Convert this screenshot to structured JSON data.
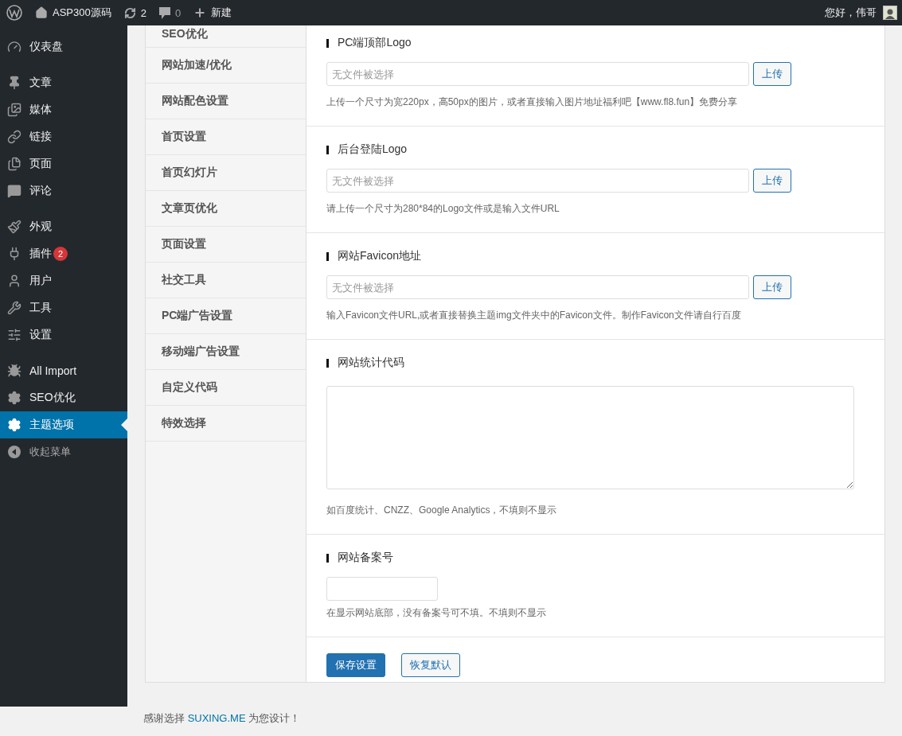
{
  "admin_bar": {
    "site": "ASP300源码",
    "updates": "2",
    "comments": "0",
    "new": "新建",
    "greeting": "您好，伟哥"
  },
  "sidebar": {
    "groups": [
      [
        {
          "label": "仪表盘",
          "selected": false
        }
      ],
      [
        {
          "label": "文章",
          "selected": false
        },
        {
          "label": "媒体",
          "selected": false
        },
        {
          "label": "链接",
          "selected": false
        },
        {
          "label": "页面",
          "selected": false
        },
        {
          "label": "评论",
          "selected": false
        }
      ],
      [
        {
          "label": "外观",
          "selected": false
        },
        {
          "label": "插件",
          "selected": false,
          "badge": "2"
        },
        {
          "label": "用户",
          "selected": false
        },
        {
          "label": "工具",
          "selected": false
        },
        {
          "label": "设置",
          "selected": false
        }
      ],
      [
        {
          "label": "All Import",
          "selected": false
        },
        {
          "label": "SEO优化",
          "selected": false
        },
        {
          "label": "主题选项",
          "selected": true
        }
      ]
    ],
    "collapse": "收起菜单"
  },
  "tabs": [
    {
      "label": "SEO优化"
    },
    {
      "label": "网站加速/优化"
    },
    {
      "label": "网站配色设置"
    },
    {
      "label": "首页设置"
    },
    {
      "label": "首页幻灯片"
    },
    {
      "label": "文章页优化"
    },
    {
      "label": "页面设置"
    },
    {
      "label": "社交工具"
    },
    {
      "label": "PC端广告设置"
    },
    {
      "label": "移动端广告设置"
    },
    {
      "label": "自定义代码"
    },
    {
      "label": "特效选择"
    }
  ],
  "sections": [
    {
      "kind": "upload",
      "title": "PC端顶部Logo",
      "placeholder": "无文件被选择",
      "button": "上传",
      "help": "上传一个尺寸为宽220px，高50px的图片，或者直接输入图片地址福利吧【www.fl8.fun】免费分享"
    },
    {
      "kind": "upload",
      "title": "后台登陆Logo",
      "placeholder": "无文件被选择",
      "button": "上传",
      "help": "请上传一个尺寸为280*84的Logo文件或是输入文件URL"
    },
    {
      "kind": "upload",
      "title": "网站Favicon地址",
      "placeholder": "无文件被选择",
      "button": "上传",
      "help": "输入Favicon文件URL,或者直接替换主题img文件夹中的Favicon文件。制作Favicon文件请自行百度"
    },
    {
      "kind": "textarea",
      "title": "网站统计代码",
      "help": "如百度统计、CNZZ、Google Analytics，不填则不显示"
    },
    {
      "kind": "text",
      "title": "网站备案号",
      "help": "在显示网站底部，没有备案号可不填。不填则不显示"
    }
  ],
  "actions": [
    {
      "label": "保存设置",
      "kind": "primary"
    },
    {
      "label": "恢复默认",
      "kind": "secondary"
    }
  ],
  "footer": {
    "before": "感谢选择",
    "link": "SUXING.ME",
    "after": "为您设计！"
  }
}
